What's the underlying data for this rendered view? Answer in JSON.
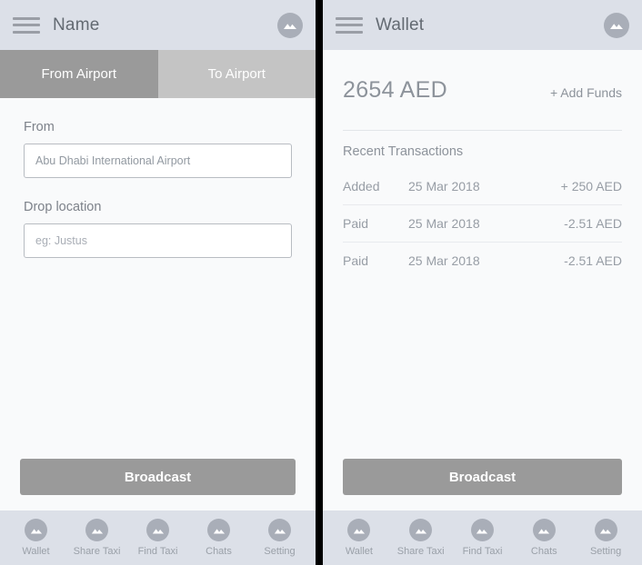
{
  "left": {
    "header": {
      "menu_icon": "hamburger-icon",
      "title": "Name",
      "avatar_icon": "image-placeholder-icon"
    },
    "tabs": [
      {
        "label": "From Airport",
        "active": true
      },
      {
        "label": "To Airport",
        "active": false
      }
    ],
    "form": {
      "from_label": "From",
      "from_value": "Abu Dhabi International Airport",
      "drop_label": "Drop location",
      "drop_value": "",
      "drop_placeholder": "eg: Justus"
    },
    "broadcast_label": "Broadcast"
  },
  "right": {
    "header": {
      "menu_icon": "hamburger-icon",
      "title": "Wallet",
      "avatar_icon": "image-placeholder-icon"
    },
    "wallet": {
      "balance": "2654 AED",
      "add_funds_label": "+ Add Funds",
      "section_title": "Recent Transactions",
      "transactions": [
        {
          "type": "Added",
          "date": "25 Mar 2018",
          "amount": "+ 250 AED"
        },
        {
          "type": "Paid",
          "date": "25 Mar 2018",
          "amount": "-2.51 AED"
        },
        {
          "type": "Paid",
          "date": "25 Mar 2018",
          "amount": "-2.51 AED"
        }
      ]
    },
    "broadcast_label": "Broadcast"
  },
  "bottom_nav": [
    {
      "label": "Wallet",
      "icon": "image-placeholder-icon"
    },
    {
      "label": "Share Taxi",
      "icon": "image-placeholder-icon"
    },
    {
      "label": "Find Taxi",
      "icon": "image-placeholder-icon"
    },
    {
      "label": "Chats",
      "icon": "image-placeholder-icon"
    },
    {
      "label": "Setting",
      "icon": "image-placeholder-icon"
    }
  ],
  "colors": {
    "appbar": "#dce0e8",
    "content": "#f9fafb",
    "tab_active": "#9a9a9a",
    "tab_inactive": "#c4c4c4",
    "button": "#9a9a9a",
    "icon_circle": "#a9aeb8",
    "text_muted": "#8d939b",
    "divider": "#000000"
  }
}
